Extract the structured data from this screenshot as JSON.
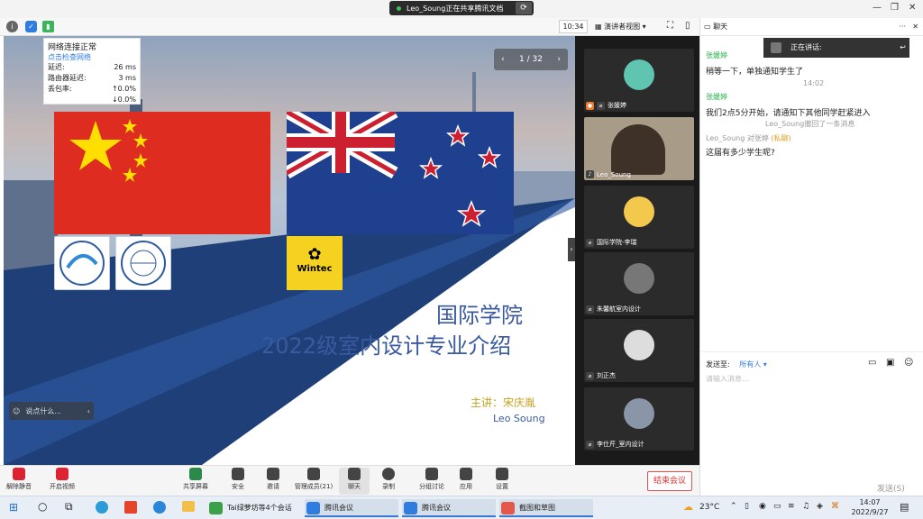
{
  "share_bar": {
    "text": "Leo_Soung正在共享腾讯文档"
  },
  "subbar": {
    "time": "10:34",
    "view_mode": "演讲者视图"
  },
  "network": {
    "status": "网络连接正常",
    "check_link": "点击检查网络",
    "rows": [
      {
        "label": "延迟:",
        "value": "26 ms"
      },
      {
        "label": "路由器延迟:",
        "value": "3 ms"
      },
      {
        "label": "丢包率:",
        "value": "↑0.0%"
      },
      {
        "label": "",
        "value": "↓0.0%"
      }
    ]
  },
  "slide": {
    "page": "1 / 32",
    "logo_text": "Wintec",
    "title_line1": "国际学院",
    "title_line2": "2022级室内设计专业介绍",
    "speaker_cn": "主讲：宋庆胤",
    "speaker_en": "Leo Soung",
    "say_placeholder": "说点什么..."
  },
  "videos": [
    {
      "name": "张媛婷"
    },
    {
      "name": "Leo_Soung"
    },
    {
      "name": "国际学院-李瑞"
    },
    {
      "name": "朱馨航室内设计"
    },
    {
      "name": "刘正杰"
    },
    {
      "name": "李仕芹_室内设计"
    }
  ],
  "chat": {
    "title": "聊天",
    "speaking": "正在讲话:",
    "messages": [
      {
        "name": "张媛婷",
        "text": "稍等一下，单独通知学生了"
      },
      {
        "time": "14:02"
      },
      {
        "name": "张媛婷",
        "text": "我们2点5分开始，请通知下其他同学赶紧进入"
      },
      {
        "sys": "Leo_Soung撤回了一条消息"
      },
      {
        "from": "Leo_Soung",
        "to": "对张婷",
        "private": "(私聊)",
        "text": "这届有多少学生呢?"
      }
    ],
    "send_to_label": "发送至:",
    "send_to_value": "所有人",
    "input_placeholder": "请输入消息...",
    "send_button": "发送(S)"
  },
  "toolbar": {
    "mute": "解除静音",
    "video": "开启视频",
    "share": "共享屏幕",
    "security": "安全",
    "invite": "邀请",
    "members": "管理成员(21)",
    "chat": "聊天",
    "record": "录制",
    "breakout": "分组讨论",
    "apps": "应用",
    "settings": "设置",
    "end": "结束会议"
  },
  "taskbar": {
    "items": [
      "Tai绿萝坊等4个会话",
      "腾讯会议",
      "腾讯会议",
      "截图和草图"
    ],
    "weather": "23°C",
    "time": "14:07",
    "date": "2022/9/27"
  }
}
